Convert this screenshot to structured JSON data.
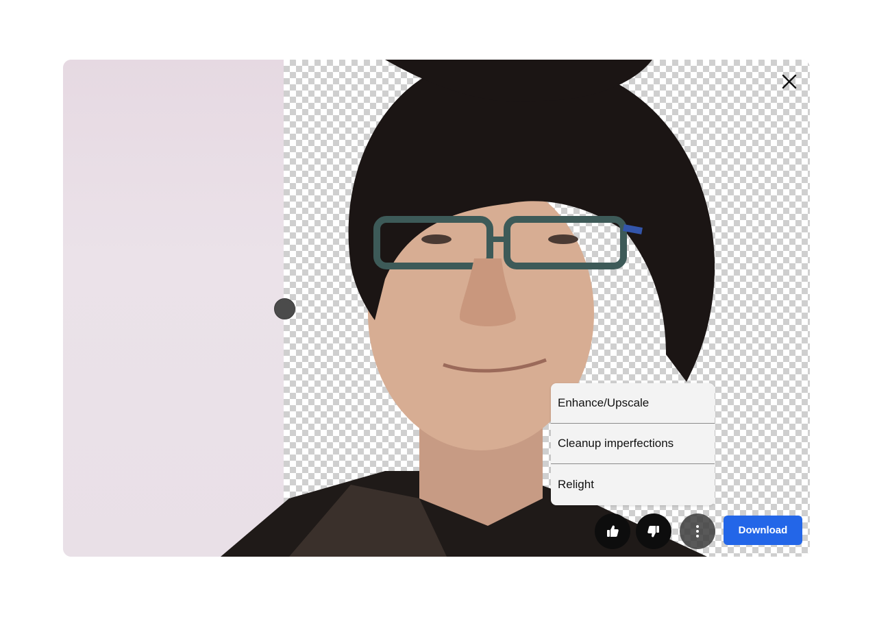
{
  "viewer": {
    "close_icon": "close-icon",
    "divider_icon": "compare-slider-handle"
  },
  "menu": {
    "items": [
      {
        "label": "Enhance/Upscale"
      },
      {
        "label": "Cleanup imperfections"
      },
      {
        "label": "Relight"
      }
    ]
  },
  "actions": {
    "thumbs_up_icon": "thumbs-up-icon",
    "thumbs_down_icon": "thumbs-down-icon",
    "more_icon": "more-vertical-icon",
    "download_label": "Download"
  },
  "colors": {
    "accent": "#2366e8",
    "menu_bg": "#f3f3f3",
    "button_dark": "#0d0d0d",
    "original_bg": "#e9e0e7"
  }
}
